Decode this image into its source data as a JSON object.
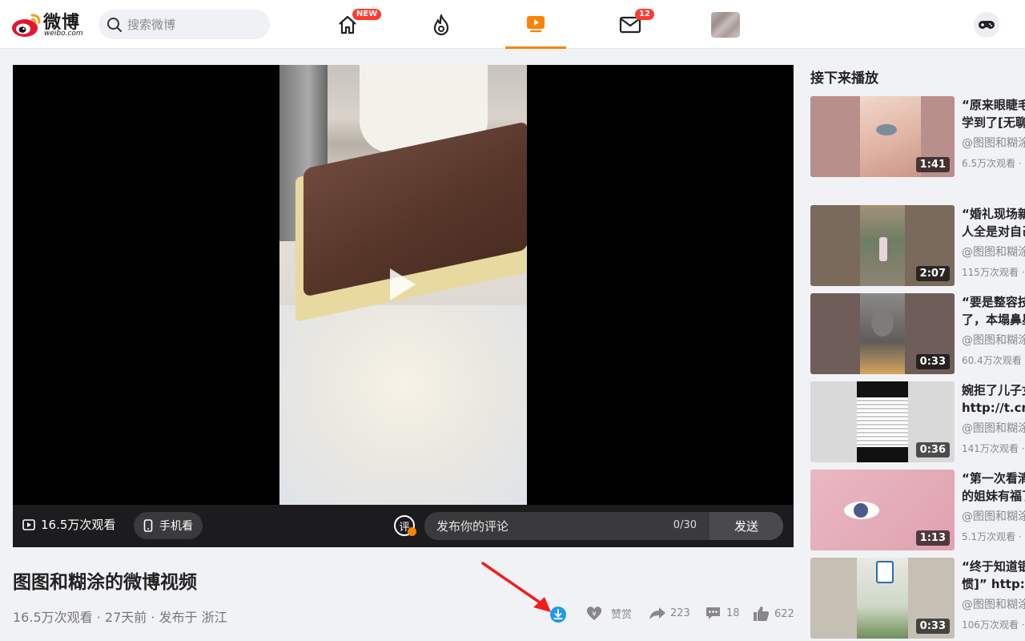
{
  "header": {
    "logo_text": "微博",
    "logo_sub": "weibo.com",
    "search_placeholder": "搜索微博",
    "nav": [
      {
        "name": "home",
        "badge": "NEW"
      },
      {
        "name": "hot",
        "badge": ""
      },
      {
        "name": "video",
        "badge": ""
      },
      {
        "name": "messages",
        "badge": "12"
      },
      {
        "name": "profile",
        "badge": ""
      }
    ]
  },
  "player": {
    "views_label": "16.5万次观看",
    "phone_label": "手机看",
    "comment_icon_text": "评",
    "comment_placeholder": "发布你的评论",
    "comment_count": "0/30",
    "send_label": "发送"
  },
  "video": {
    "title": "图图和糊涂的微博视频",
    "meta": "16.5万次观看 · 27天前 · 发布于 浙江"
  },
  "actions": {
    "reward_label": "赞赏",
    "forward_count": "223",
    "comment_count": "18",
    "like_count": "622"
  },
  "sidebar": {
    "title": "接下来播放",
    "items": [
      {
        "title_line1": "“原来眼睫毛",
        "title_line2": "学到了[无聊",
        "author": "@图图和糊涂",
        "views": "6.5万次观看 ·",
        "duration": "1:41"
      },
      {
        "title_line1": "“婚礼现场新",
        "title_line2": "人全是对自己",
        "author": "@图图和糊涂",
        "views": "115万次观看 ·",
        "duration": "2:07"
      },
      {
        "title_line1": "“要是整容技",
        "title_line2": "了，本塌鼻星",
        "author": "@图图和糊涂",
        "views": "60.4万次观看",
        "duration": "0:33"
      },
      {
        "title_line1": "婉拒了儿子女",
        "title_line2": "http://t.cn/",
        "author": "@图图和糊涂",
        "views": "141万次观看 ·",
        "duration": "0:36"
      },
      {
        "title_line1": "“第一次看清",
        "title_line2": "的姐妹有福了",
        "author": "@图图和糊涂",
        "views": "5.1万次观看 ·",
        "duration": "1:13"
      },
      {
        "title_line1": "“终于知道银",
        "title_line2": "惯]” http://",
        "author": "@图图和糊涂",
        "views": "106万次观看 ·",
        "duration": "0:33"
      }
    ]
  },
  "colors": {
    "accent": "#ff8200",
    "badge": "#ff3b30",
    "download": "#1d9bf0"
  }
}
